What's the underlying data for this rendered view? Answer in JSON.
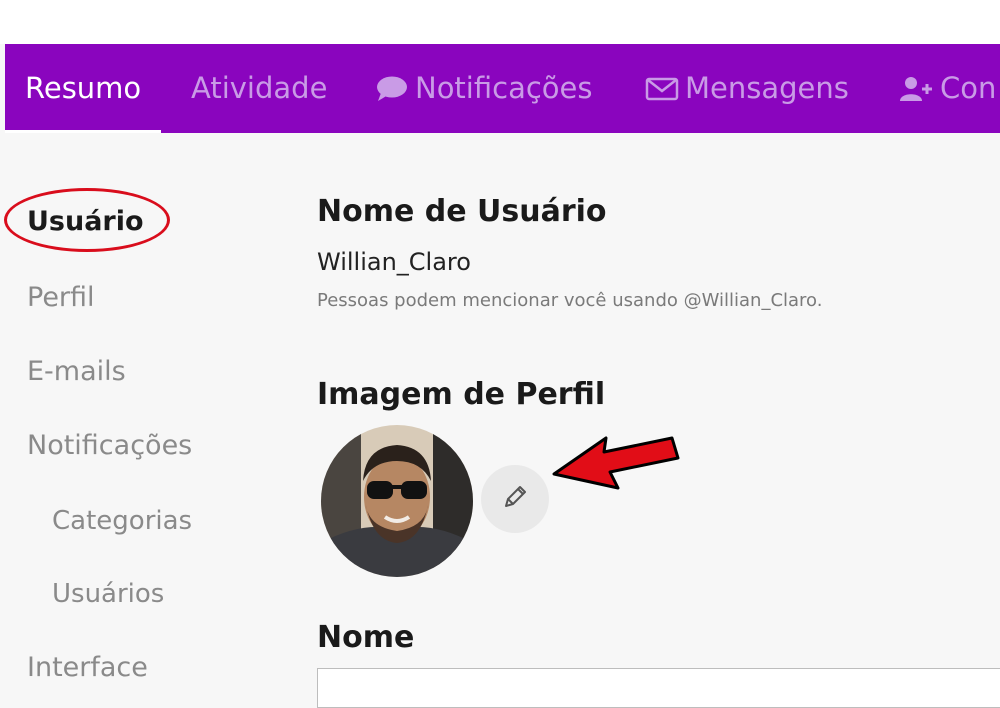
{
  "nav": {
    "items": [
      {
        "label": "Resumo",
        "active": true
      },
      {
        "label": "Atividade",
        "active": false
      },
      {
        "label": "Notificações",
        "icon": "speech-bubble-icon",
        "active": false
      },
      {
        "label": "Mensagens",
        "icon": "envelope-icon",
        "active": false
      },
      {
        "label": "Con",
        "icon": "add-user-icon",
        "active": false
      }
    ],
    "background": "#8a05be"
  },
  "sidebar": {
    "items": [
      {
        "label": "Usuário",
        "active": true
      },
      {
        "label": "Perfil"
      },
      {
        "label": "E-mails"
      },
      {
        "label": "Notificações"
      },
      {
        "label": "Categorias",
        "sub": true
      },
      {
        "label": "Usuários",
        "sub": true
      },
      {
        "label": "Interface"
      }
    ]
  },
  "main": {
    "username_heading": "Nome de Usuário",
    "username_value": "Willian_Claro",
    "username_help": "Pessoas podem mencionar você usando @Willian_Claro.",
    "profile_image_heading": "Imagem de Perfil",
    "name_heading": "Nome"
  },
  "annotations": {
    "highlight_color": "#d90d1c"
  }
}
